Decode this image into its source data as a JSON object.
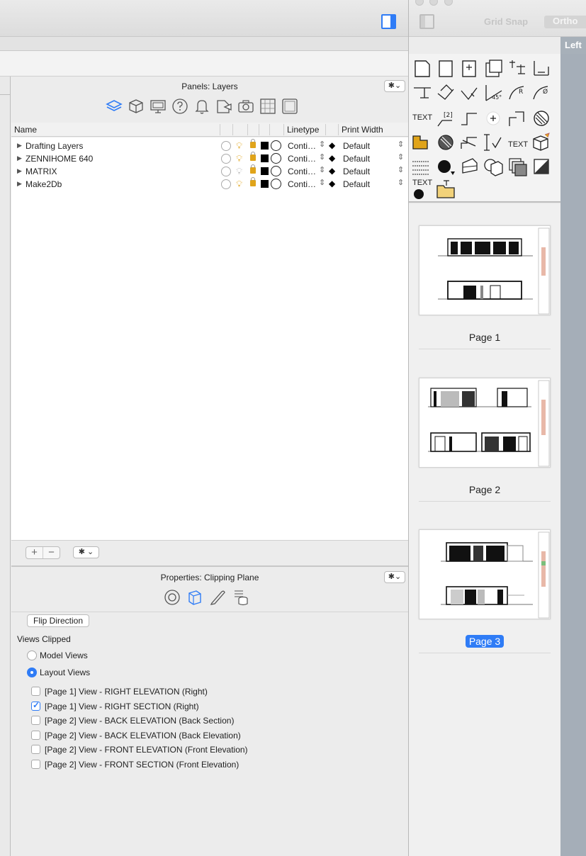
{
  "main_window": {
    "sidebar_toggle": "sidebar-toggle-icon"
  },
  "layers_panel": {
    "title": "Panels: Layers",
    "gear_label": "✱⌄",
    "columns": {
      "name": "Name",
      "linetype": "Linetype",
      "print_width": "Print Width"
    },
    "rows": [
      {
        "name": "Drafting Layers",
        "linetype": "Conti…",
        "print_width": "Default",
        "bulb": "on"
      },
      {
        "name": "ZENNIHOME 640",
        "linetype": "Conti…",
        "print_width": "Default",
        "bulb": "on"
      },
      {
        "name": "MATRIX",
        "linetype": "Conti…",
        "print_width": "Default",
        "bulb": "off"
      },
      {
        "name": "Make2Db",
        "linetype": "Conti…",
        "print_width": "Default",
        "bulb": "on"
      }
    ],
    "footer": {
      "add": "+",
      "remove": "−",
      "gear_label": "✱ ⌄"
    }
  },
  "properties_panel": {
    "title": "Properties: Clipping Plane",
    "gear_label": "✱⌄",
    "flip_button": "Flip Direction",
    "views_clipped_label": "Views Clipped",
    "radio_options": [
      {
        "label": "Model Views",
        "selected": false
      },
      {
        "label": "Layout Views",
        "selected": true
      }
    ],
    "view_list": [
      {
        "label": "[Page 1] View - RIGHT ELEVATION (Right)",
        "checked": false
      },
      {
        "label": "[Page 1] View -  RIGHT SECTION (Right)",
        "checked": true
      },
      {
        "label": "[Page 2] View - BACK ELEVATION (Back Section)",
        "checked": false
      },
      {
        "label": "[Page 2] View - BACK ELEVATION (Back Elevation)",
        "checked": false
      },
      {
        "label": "[Page 2] View - FRONT ELEVATION (Front Elevation)",
        "checked": false
      },
      {
        "label": "[Page 2] View - FRONT SECTION (Front Elevation)",
        "checked": false
      }
    ]
  },
  "right_window": {
    "grid_snap": "Grid Snap",
    "ortho": "Ortho",
    "left_tab": "Left",
    "tool_text_1": "TEXT",
    "tool_text_2": "TEXT",
    "tool_text_3": "TEXT",
    "tool_text_4": "[2]",
    "pages": [
      {
        "label": "Page 1",
        "selected": false
      },
      {
        "label": "Page 2",
        "selected": false
      },
      {
        "label": "Page 3",
        "selected": true
      }
    ]
  },
  "colors": {
    "accent": "#2f7cf6",
    "bulb": "#e0a41a",
    "strip": "#a5aeb8"
  }
}
